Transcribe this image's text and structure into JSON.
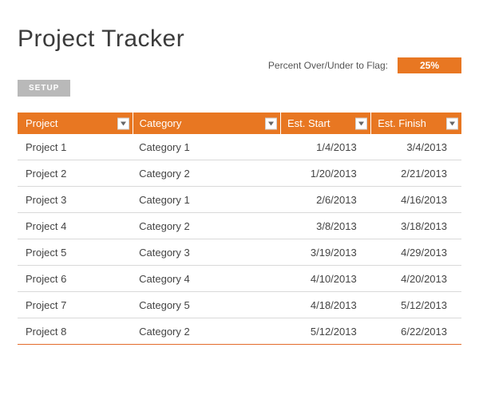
{
  "title": "Project Tracker",
  "flag": {
    "label": "Percent Over/Under to Flag:",
    "value": "25%"
  },
  "setup_btn": "SETUP",
  "columns": {
    "project": "Project",
    "category": "Category",
    "est_start": "Est. Start",
    "est_finish": "Est. Finish"
  },
  "rows": [
    {
      "project": "Project 1",
      "category": "Category 1",
      "est_start": "1/4/2013",
      "est_finish": "3/4/2013"
    },
    {
      "project": "Project 2",
      "category": "Category 2",
      "est_start": "1/20/2013",
      "est_finish": "2/21/2013"
    },
    {
      "project": "Project 3",
      "category": "Category 1",
      "est_start": "2/6/2013",
      "est_finish": "4/16/2013"
    },
    {
      "project": "Project 4",
      "category": "Category 2",
      "est_start": "3/8/2013",
      "est_finish": "3/18/2013"
    },
    {
      "project": "Project 5",
      "category": "Category 3",
      "est_start": "3/19/2013",
      "est_finish": "4/29/2013"
    },
    {
      "project": "Project 6",
      "category": "Category 4",
      "est_start": "4/10/2013",
      "est_finish": "4/20/2013"
    },
    {
      "project": "Project 7",
      "category": "Category 5",
      "est_start": "4/18/2013",
      "est_finish": "5/12/2013"
    },
    {
      "project": "Project 8",
      "category": "Category 2",
      "est_start": "5/12/2013",
      "est_finish": "6/22/2013"
    }
  ]
}
